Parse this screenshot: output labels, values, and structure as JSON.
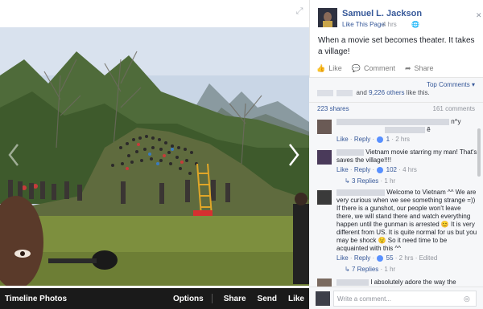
{
  "viewer": {
    "bar_title": "Timeline Photos",
    "options_label": "Options",
    "share_label": "Share",
    "send_label": "Send",
    "like_label": "Like",
    "expand_icon": "expand-icon",
    "next_icon": "chevron-right-icon",
    "prev_icon": "chevron-left-icon"
  },
  "post": {
    "page_name": "Samuel L. Jackson",
    "like_page": "Like This Page",
    "time": "4 hrs",
    "text": "When a movie set becomes theater. It takes a village!",
    "actions": {
      "like": "Like",
      "comment": "Comment",
      "share": "Share"
    }
  },
  "stats": {
    "top_comments": "Top Comments ▾",
    "likes_prefix": "and",
    "likes_others": "9,226 others",
    "likes_suffix": "like this.",
    "shares": "223 shares",
    "comments": "161 comments"
  },
  "comments": [
    {
      "text": "n^y",
      "text2": "ẽ",
      "like": "Like",
      "reply": "Reply",
      "likes": "1",
      "time": "2 hrs"
    },
    {
      "text": "Vietnam movie starring my man! That's saves the village!!!!",
      "like": "Like",
      "reply": "Reply",
      "likes": "102",
      "time": "4 hrs",
      "replies": "3 Replies",
      "replies_time": "1 hr"
    },
    {
      "text": "Welcome to Vietnam ^^ We are very curious when we see something strange =)) If there is a gunshot, our people won't leave there, we will stand there and watch everything happen until the gunman is arrested 😊 It is very different from US. It is quite normal for us but you may be shock 😟 So it need time to be acquainted with this ^^",
      "like": "Like",
      "reply": "Reply",
      "likes": "55",
      "time": "2 hrs",
      "edited": "Edited",
      "replies": "7 Replies",
      "replies_time": "1 hr"
    },
    {
      "text": "I absolutely adore the way the"
    }
  ],
  "composer": {
    "placeholder": "Write a comment...",
    "camera_icon": "camera-icon"
  },
  "colors": {
    "link": "#365899",
    "muted": "#90949c",
    "bar_bg": "#1a1a1a",
    "sidebar_bg": "#f6f7f9"
  }
}
